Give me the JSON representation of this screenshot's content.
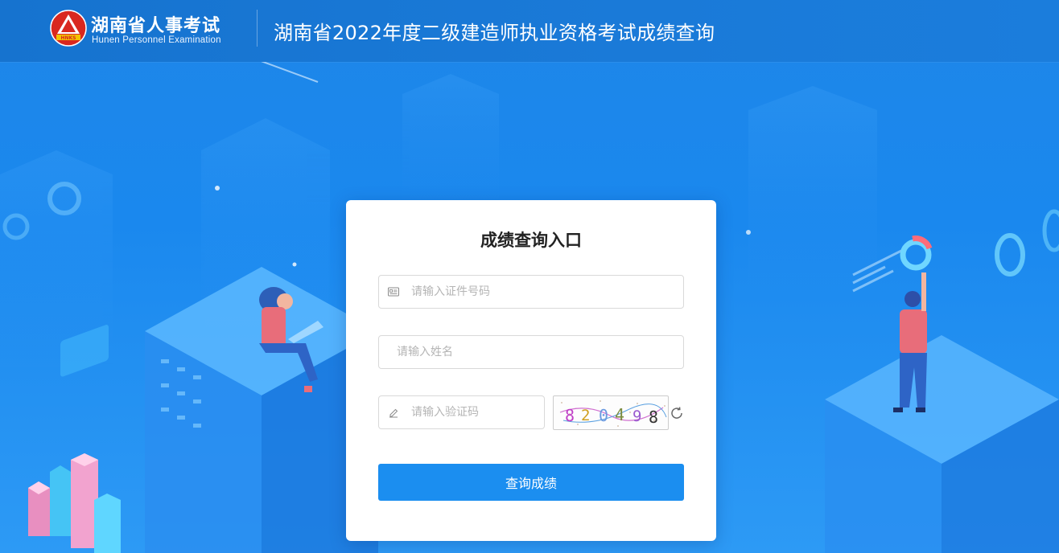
{
  "header": {
    "brand_cn": "湖南省人事考试",
    "brand_en": "Hunen Personnel Examination",
    "logo_text": "HNKS",
    "page_title": "湖南省2022年度二级建造师执业资格考试成绩查询"
  },
  "card": {
    "title": "成绩查询入口",
    "id_placeholder": "请输入证件号码",
    "name_placeholder": "请输入姓名",
    "code_placeholder": "请输入验证码",
    "captcha_text": [
      "8",
      "2",
      "0",
      "4",
      "9",
      "8"
    ],
    "submit_label": "查询成绩"
  },
  "icons": [
    "id-card-icon",
    "pencil-icon",
    "refresh-icon"
  ],
  "colors": {
    "header": "#1673cf",
    "background": "#1e86e8",
    "button": "#1b8ef0"
  }
}
